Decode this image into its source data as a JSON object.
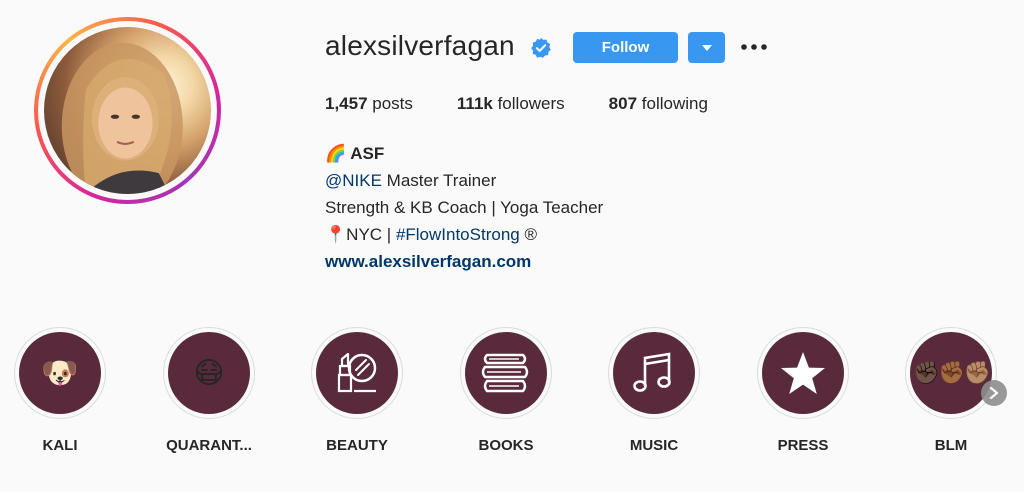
{
  "profile": {
    "username": "alexsilverfagan",
    "verified_icon": "verified-badge-icon",
    "follow_label": "Follow",
    "more_icon": "more-options-icon"
  },
  "stats": {
    "posts_count": "1,457",
    "posts_label": " posts",
    "followers_count": "111k",
    "followers_label": " followers",
    "following_count": "807",
    "following_label": " following"
  },
  "bio": {
    "name_emoji": "🌈",
    "name": "ASF",
    "line1_mention": "@NIKE",
    "line1_rest": " Master Trainer",
    "line2": "Strength & KB Coach | Yoga Teacher",
    "line3_pin": "📍",
    "line3_city": "NYC | ",
    "line3_hashtag": "#FlowIntoStrong",
    "line3_mark": " ®",
    "website": "www.alexsilverfagan.com"
  },
  "highlights": [
    {
      "label": "KALI",
      "icon": "dog-emoji-icon",
      "glyph": "🐶"
    },
    {
      "label": "QUARANT...",
      "icon": "mask-face-emoji-icon",
      "glyph": "😷"
    },
    {
      "label": "BEAUTY",
      "icon": "lipstick-mirror-icon"
    },
    {
      "label": "BOOKS",
      "icon": "books-icon"
    },
    {
      "label": "MUSIC",
      "icon": "music-note-icon"
    },
    {
      "label": "PRESS",
      "icon": "star-icon"
    },
    {
      "label": "BLM",
      "icon": "raised-fists-emoji-icon",
      "glyph": "✊🏿✊🏾✊🏽"
    }
  ],
  "colors": {
    "accent_blue": "#3897f0",
    "link_blue": "#00376b",
    "highlight_bg": "#592a3c"
  }
}
